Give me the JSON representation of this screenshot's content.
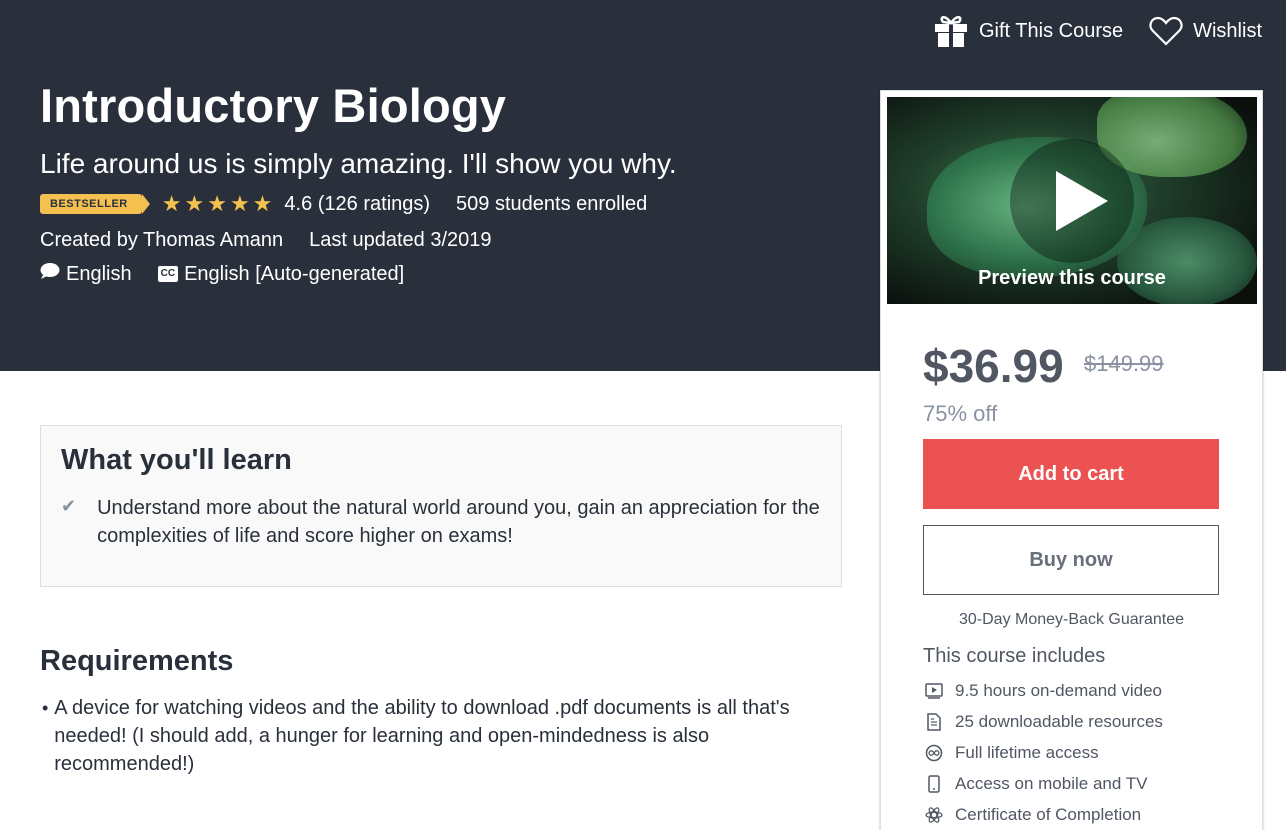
{
  "header": {
    "gift_label": "Gift This Course",
    "wishlist_label": "Wishlist"
  },
  "course": {
    "title": "Introductory Biology",
    "subtitle": "Life around us is simply amazing. I'll show you why.",
    "badge": "BESTSELLER",
    "rating_value": 4.6,
    "rating_text": "4.6 (126 ratings)",
    "enrolled": "509 students enrolled",
    "created_by": "Created by Thomas Amann",
    "last_updated": "Last updated 3/2019",
    "language": "English",
    "captions_icon": "CC",
    "captions": "English [Auto-generated]"
  },
  "sidebar": {
    "preview_label": "Preview this course",
    "price": "$36.99",
    "original_price": "$149.99",
    "discount": "75% off",
    "add_to_cart": "Add to cart",
    "buy_now": "Buy now",
    "guarantee": "30-Day Money-Back Guarantee",
    "includes_title": "This course includes",
    "includes": [
      {
        "icon": "video-icon",
        "label": "9.5 hours on-demand video"
      },
      {
        "icon": "file-icon",
        "label": "25 downloadable resources"
      },
      {
        "icon": "infinity-icon",
        "label": "Full lifetime access"
      },
      {
        "icon": "mobile-icon",
        "label": "Access on mobile and TV"
      },
      {
        "icon": "certificate-icon",
        "label": "Certificate of Completion"
      }
    ]
  },
  "learn": {
    "title": "What you'll learn",
    "items": [
      "Understand more about the natural world around you, gain an appreciation for the complexities of life and score higher on exams!"
    ]
  },
  "requirements": {
    "title": "Requirements",
    "items": [
      "A device for watching videos and the ability to download .pdf documents is all that's needed! (I should add, a hunger for learning and open-mindedness is also recommended!)"
    ]
  },
  "colors": {
    "hero_bg": "#29303b",
    "accent": "#ec5252",
    "star": "#f4c150"
  }
}
